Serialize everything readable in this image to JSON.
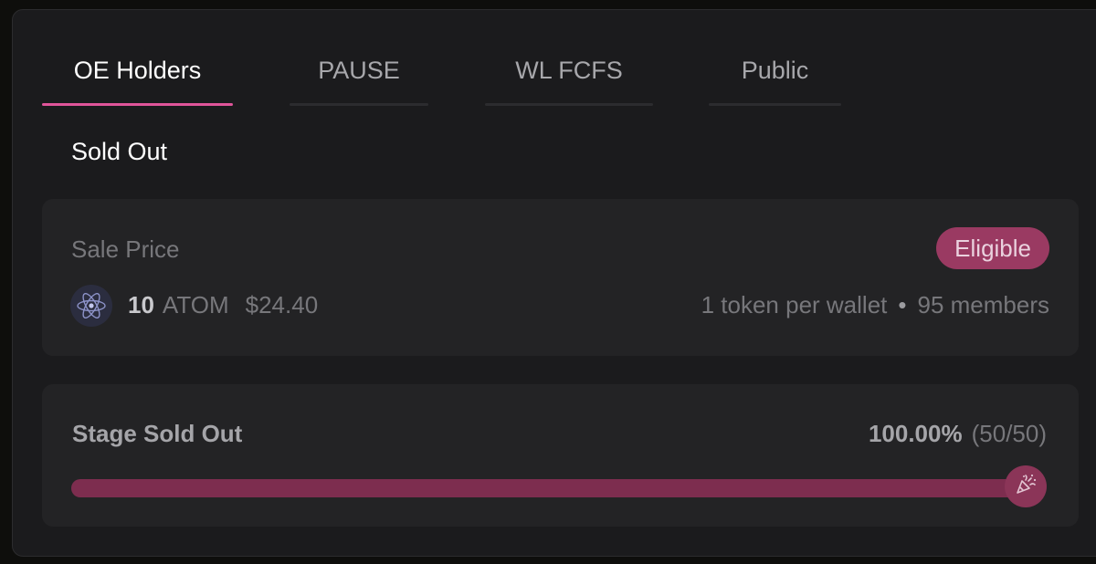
{
  "tabs": [
    {
      "label": "OE Holders",
      "active": true
    },
    {
      "label": "PAUSE",
      "active": false
    },
    {
      "label": "WL FCFS",
      "active": false
    },
    {
      "label": "Public",
      "active": false
    }
  ],
  "stage_status": "Sold Out",
  "sale": {
    "label": "Sale Price",
    "badge": "Eligible",
    "token_icon": "cosmos-atom-icon",
    "amount": "10",
    "unit": "ATOM",
    "usd": "$24.40",
    "per_wallet": "1 token per wallet",
    "separator": "•",
    "members": "95 members"
  },
  "progress": {
    "label": "Stage Sold Out",
    "percent_text": "100.00%",
    "count_text": "(50/50)",
    "fraction": 1.0,
    "knob_icon": "party-popper-icon"
  },
  "colors": {
    "accent": "#e0559a",
    "badge_bg": "#9a3a62",
    "progress_fill": "#7d2d4f"
  }
}
